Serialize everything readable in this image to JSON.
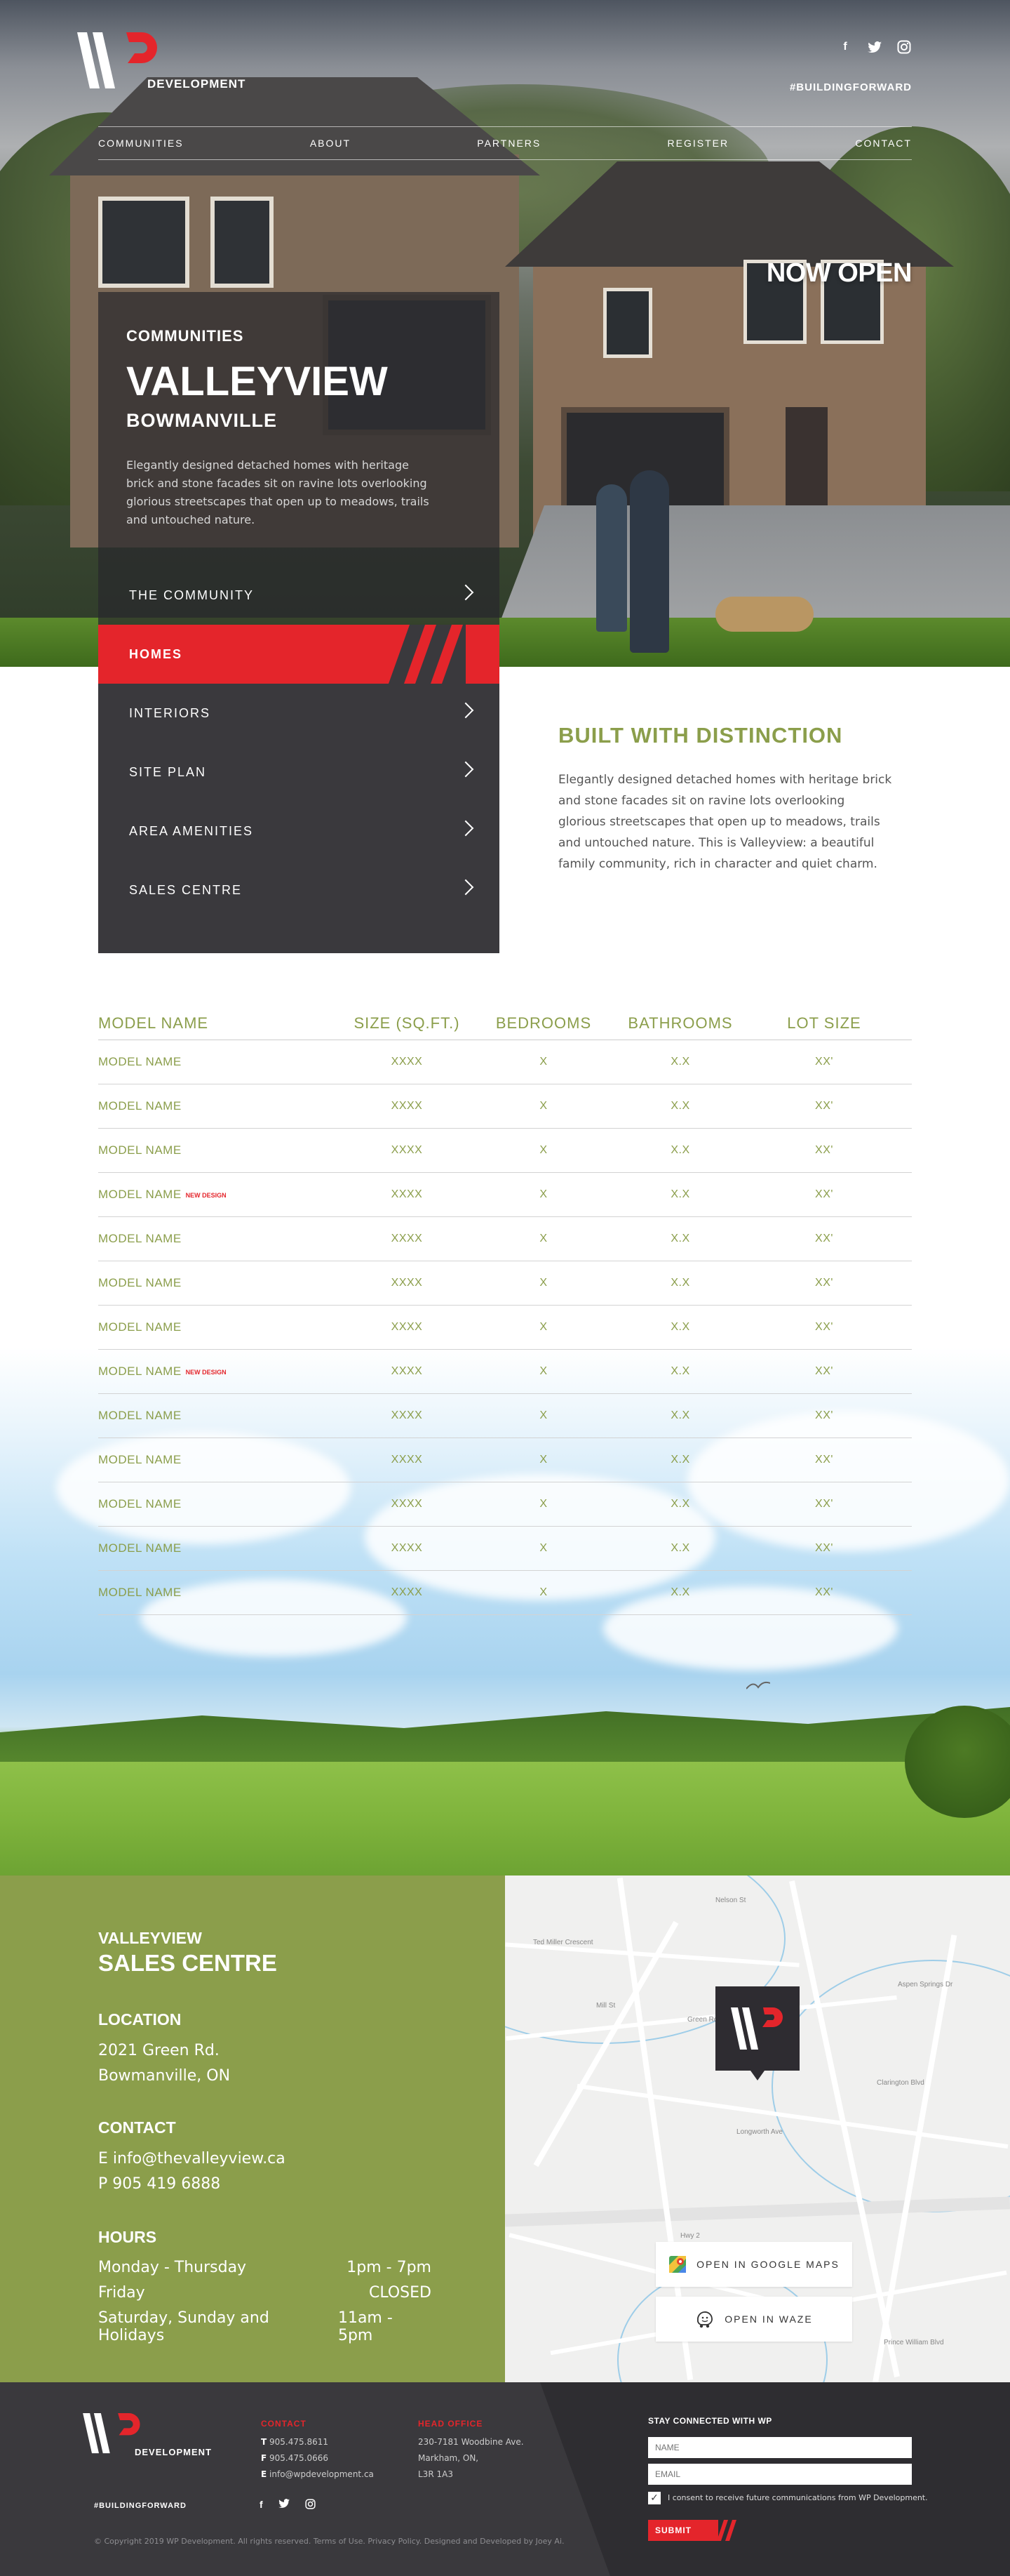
{
  "header": {
    "logo_text": "DEVELOPMENT",
    "hashtag": "#BUILDINGFORWARD",
    "social_icons": [
      "facebook-icon",
      "twitter-icon",
      "instagram-icon"
    ],
    "nav": [
      "COMMUNITIES",
      "ABOUT",
      "PARTNERS",
      "REGISTER",
      "CONTACT"
    ]
  },
  "hero": {
    "badge": "NOW OPEN"
  },
  "community": {
    "label": "COMMUNITIES",
    "title": "VALLEYVIEW",
    "subtitle": "BOWMANVILLE",
    "description": "Elegantly designed detached homes with heritage brick and stone facades sit on ravine lots overlooking glorious streetscapes that open up to meadows, trails and untouched nature."
  },
  "menu": [
    {
      "label": "THE COMMUNITY",
      "active": false
    },
    {
      "label": "HOMES",
      "active": true
    },
    {
      "label": "INTERIORS",
      "active": false
    },
    {
      "label": "SITE PLAN",
      "active": false
    },
    {
      "label": "AREA AMENITIES",
      "active": false
    },
    {
      "label": "SALES CENTRE",
      "active": false
    }
  ],
  "distinction": {
    "title": "BUILT WITH DISTINCTION",
    "text": "Elegantly designed detached homes with heritage brick and stone facades sit on ravine lots overlooking glorious streetscapes that open up to meadows, trails and untouched nature. This is Valleyview: a beautiful family community, rich in character and quiet charm."
  },
  "models": {
    "headers": [
      "MODEL NAME",
      "SIZE (SQ.FT.)",
      "BEDROOMS",
      "BATHROOMS",
      "LOT SIZE"
    ],
    "rows": [
      {
        "name": "MODEL NAME",
        "badge": "",
        "size": "XXXX",
        "beds": "X",
        "baths": "X.X",
        "lot": "XX'"
      },
      {
        "name": "MODEL NAME",
        "badge": "",
        "size": "XXXX",
        "beds": "X",
        "baths": "X.X",
        "lot": "XX'"
      },
      {
        "name": "MODEL NAME",
        "badge": "",
        "size": "XXXX",
        "beds": "X",
        "baths": "X.X",
        "lot": "XX'"
      },
      {
        "name": "MODEL NAME",
        "badge": "NEW DESIGN",
        "size": "XXXX",
        "beds": "X",
        "baths": "X.X",
        "lot": "XX'"
      },
      {
        "name": "MODEL NAME",
        "badge": "",
        "size": "XXXX",
        "beds": "X",
        "baths": "X.X",
        "lot": "XX'"
      },
      {
        "name": "MODEL NAME",
        "badge": "",
        "size": "XXXX",
        "beds": "X",
        "baths": "X.X",
        "lot": "XX'"
      },
      {
        "name": "MODEL NAME",
        "badge": "",
        "size": "XXXX",
        "beds": "X",
        "baths": "X.X",
        "lot": "XX'"
      },
      {
        "name": "MODEL NAME",
        "badge": "NEW DESIGN",
        "size": "XXXX",
        "beds": "X",
        "baths": "X.X",
        "lot": "XX'"
      },
      {
        "name": "MODEL NAME",
        "badge": "",
        "size": "XXXX",
        "beds": "X",
        "baths": "X.X",
        "lot": "XX'"
      },
      {
        "name": "MODEL NAME",
        "badge": "",
        "size": "XXXX",
        "beds": "X",
        "baths": "X.X",
        "lot": "XX'"
      },
      {
        "name": "MODEL NAME",
        "badge": "",
        "size": "XXXX",
        "beds": "X",
        "baths": "X.X",
        "lot": "XX'"
      },
      {
        "name": "MODEL NAME",
        "badge": "",
        "size": "XXXX",
        "beds": "X",
        "baths": "X.X",
        "lot": "XX'"
      },
      {
        "name": "MODEL NAME",
        "badge": "",
        "size": "XXXX",
        "beds": "X",
        "baths": "X.X",
        "lot": "XX'"
      }
    ]
  },
  "sales": {
    "small_title": "VALLEYVIEW",
    "big_title": "SALES CENTRE",
    "location_label": "LOCATION",
    "address_1": "2021 Green Rd.",
    "address_2": "Bowmanville, ON",
    "contact_label": "CONTACT",
    "email_prefix": "E",
    "email": "info@thevalleyview.ca",
    "phone_prefix": "P",
    "phone": "905 419 6888",
    "hours_label": "HOURS",
    "hours": [
      {
        "day": "Monday - Thursday",
        "time": "1pm - 7pm"
      },
      {
        "day": "Friday",
        "time": "CLOSED"
      },
      {
        "day": "Saturday, Sunday and Holidays",
        "time": "11am - 5pm"
      }
    ]
  },
  "map": {
    "google_button": "OPEN IN GOOGLE MAPS",
    "waze_button": "OPEN IN WAZE",
    "street_labels": [
      "Nelson St",
      "Mill St",
      "Ted Miller Crescent",
      "Hwy 2",
      "Green Rd",
      "Prince William Blvd",
      "Longworth Ave",
      "Clarington Blvd",
      "Aspen Springs Dr"
    ]
  },
  "footer": {
    "logo_text": "DEVELOPMENT",
    "contact_label": "CONTACT",
    "contact_lines": [
      {
        "k": "T",
        "v": "905.475.8611"
      },
      {
        "k": "F",
        "v": "905.475.0666"
      },
      {
        "k": "E",
        "v": "info@wpdevelopment.ca"
      }
    ],
    "head_office_label": "HEAD OFFICE",
    "head_office_lines": [
      "230-7181 Woodbine Ave.",
      "Markham, ON,",
      "L3R 1A3"
    ],
    "hashtag": "#BUILDINGFORWARD",
    "copyright": "© Copyright 2019 WP Development. All rights reserved. Terms of Use. Privacy Policy. Designed and Developed by Joey Ai.",
    "stay_label": "STAY CONNECTED WITH WP",
    "name_placeholder": "NAME",
    "email_placeholder": "EMAIL",
    "consent": "I consent to receive future communications from WP Development.",
    "submit": "SUBMIT"
  },
  "colors": {
    "accent_red": "#e4252b",
    "olive": "#8b9e4b",
    "charcoal": "#3a393d"
  }
}
